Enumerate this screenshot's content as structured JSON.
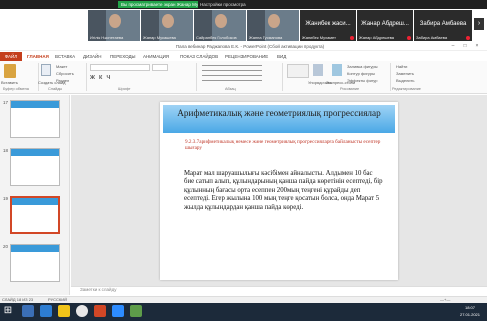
{
  "zoom": {
    "banner": "Вы просматриваете экран Жанар Мукашева",
    "settings": "Настройки просмотра",
    "participants": [
      {
        "name": "Игілік Нәспетаева",
        "type": "camera"
      },
      {
        "name": "Жанар Мукашева",
        "type": "camera"
      },
      {
        "name": "Сайранбек Голобоков",
        "type": "camera"
      },
      {
        "name": "Жанна Гусманова",
        "type": "camera"
      },
      {
        "name": "Жанибек Мухамет",
        "type": "name"
      },
      {
        "name": "Жанар Абдрешева",
        "type": "name"
      },
      {
        "name": "Забира Амбаева",
        "type": "name"
      }
    ],
    "tile_big_names": [
      "Жанибек жаси...",
      "Жанар Абдреш...",
      "Забира Амбаева"
    ]
  },
  "ppt": {
    "title": "Пала вебинар Раджапова Е.К. - PowerPoint (Сбой активации продукта)",
    "tabs": [
      "ФАЙЛ",
      "ГЛАВНАЯ",
      "ВСТАВКА",
      "ДИЗАЙН",
      "ПЕРЕХОДЫ",
      "АНИМАЦИЯ",
      "ПОКАЗ СЛАЙДОВ",
      "РЕЦЕНЗИРОВАНИЕ",
      "ВИД"
    ],
    "ribbon": {
      "paste": "Вставить",
      "clipboard_group": "Буфер обмена",
      "layout": "Макет",
      "reset": "Сбросить",
      "section": "Раздел",
      "slides_group": "Слайды",
      "create": "Создать слайд",
      "font_group": "Шрифт",
      "paragraph_group": "Абзац",
      "arrange": "Упорядочить",
      "quick_styles": "Экспресс-стили",
      "fill": "Заливка фигуры",
      "outline": "Контур фигуры",
      "effects": "Эффекты фигур",
      "drawing_group": "Рисование",
      "find": "Найти",
      "replace": "Заменить",
      "select": "Выделить",
      "editing_group": "Редактирование"
    },
    "thumbs": [
      "17",
      "18",
      "19",
      "20"
    ],
    "slide": {
      "title": "Арифметикалық және геометриялық прогрессиялар",
      "subtitle": "9.2.3.7арифметикалық немесе және геометриялық прогрессияларға байланысты есептер шығару",
      "body": "Марат мал шаруашылығы кәсібімен айналысты. Алдымен 10 бас бие сатып алып, құлындарының қанша пайда көретінін есептеді, бір құлынның бағасы орта есеппен 200мың теңгені құрайды деп есептеді. Егер жылына 100 мың теңге қосатын болса, онда Марат 5 жылда құлындардан қанша пайда көреді."
    },
    "notes": "Заметки к слайду",
    "status_slide": "СЛАЙД 18 ИЗ 23",
    "status_lang": "РУССКИЙ",
    "status_zoom": "—+—"
  },
  "taskbar": {
    "time": "18:07",
    "date": "27.01.2021"
  },
  "colors": {
    "ppt_accent": "#c43e1c",
    "slide_header": "#4aa8e6",
    "zoom_green": "#23a44a"
  }
}
